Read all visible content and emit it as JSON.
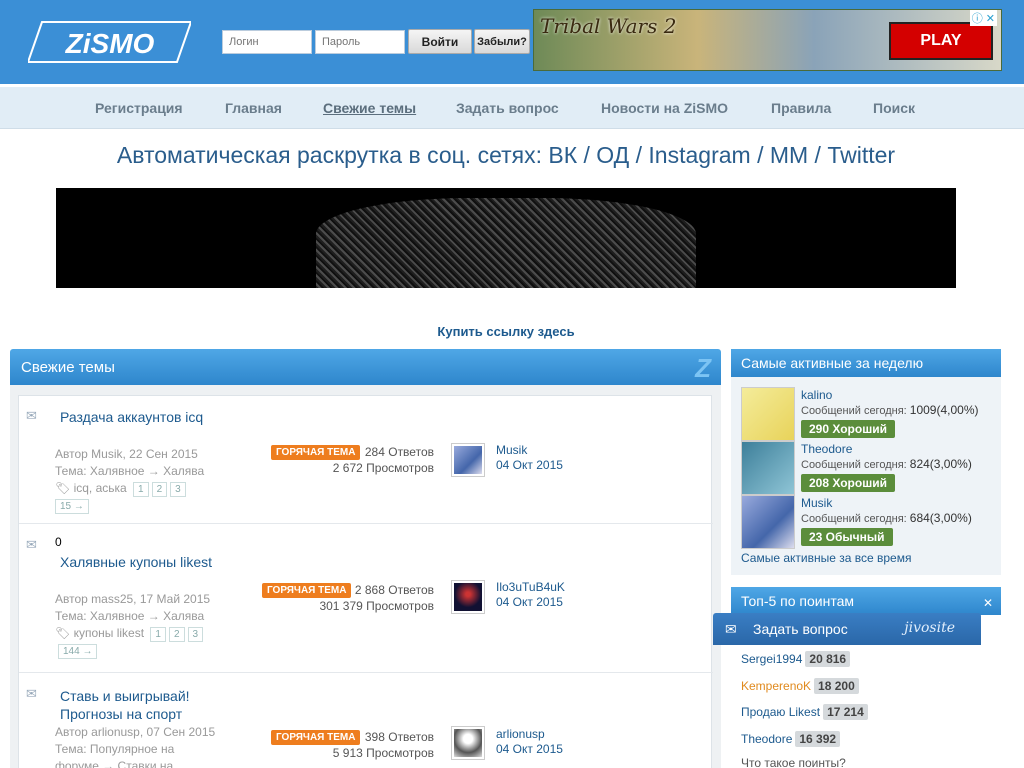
{
  "header": {
    "logo_text": "ZiSMO",
    "login_placeholder": "Логин",
    "password_placeholder": "Пароль",
    "login_button": "Войти",
    "forgot_button": "Забыли?",
    "ad_title": "Tribal Wars 2",
    "ad_play": "PLAY"
  },
  "nav": [
    "Регистрация",
    "Главная",
    "Свежие темы",
    "Задать вопрос",
    "Новости на ZiSMO",
    "Правила",
    "Поиск"
  ],
  "promo": "Автоматическая раскрутка в соц. сетях: ВК / ОД / Instagram / ММ / Twitter",
  "buy_link": "Купить ссылку здесь",
  "topics": {
    "header": "Свежие темы",
    "hot_label": "ГОРЯЧАЯ ТЕМА",
    "items": [
      {
        "title": "Раздача аккаунтов icq",
        "meta": "Автор Musik, 22 Сен 2015 Тема: Халявное → Халява",
        "tags": "icq, аська",
        "pages": [
          "1",
          "2",
          "3",
          "15 →"
        ],
        "replies": "284 Ответов",
        "views": "2 672 Просмотров",
        "last_user": "Musik",
        "last_date": "04 Окт 2015"
      },
      {
        "marker": "0",
        "title": "Халявные купоны likest",
        "meta": "Автор mass25, 17 Май 2015 Тема: Халявное → Халява",
        "tags": "купоны likest",
        "pages": [
          "1",
          "2",
          "3",
          "144 →"
        ],
        "replies": "2 868 Ответов",
        "views": "301 379 Просмотров",
        "last_user": "Ilo3uTuB4uK",
        "last_date": "04 Окт 2015"
      },
      {
        "title": "Ставь и выигрывай! Прогнозы на спорт",
        "meta": "Автор arlionusp, 07 Сен 2015 Тема: Популярное на форуме → Ставки на",
        "replies": "398 Ответов",
        "views": "5 913 Просмотров",
        "last_user": "arlionusp",
        "last_date": "04 Окт 2015"
      }
    ]
  },
  "sidebar": {
    "active_header": "Самые активные за неделю",
    "messages_label": "Сообщений сегодня:",
    "members": [
      {
        "name": "kalino",
        "count": "1009(4,00%)",
        "rep": "290 Хороший"
      },
      {
        "name": "Theodore",
        "count": "824(3,00%)",
        "rep": "208 Хороший"
      },
      {
        "name": "Musik",
        "count": "684(3,00%)",
        "rep": "23 Обычный"
      }
    ],
    "all_time_link": "Самые активные за все время",
    "top5_header": "Топ-5 по поинтам",
    "top5": [
      {
        "name": "Sergei1994",
        "points": "20 816"
      },
      {
        "name": "KemperenoK",
        "points": "18 200"
      },
      {
        "name": "Продаю Likest",
        "points": "17 214"
      },
      {
        "name": "Theodore",
        "points": "16 392"
      }
    ],
    "points_link": "Что такое поинты?"
  },
  "jivo": {
    "label": "Задать вопрос",
    "brand": "jivosite"
  },
  "colors": {
    "header_blue": "#3b8fd6",
    "link_blue": "#1d5a8e",
    "hot_orange": "#ee7d1e",
    "rep_green": "#5b8d3b",
    "top5_highlight": "#e08a1e"
  }
}
